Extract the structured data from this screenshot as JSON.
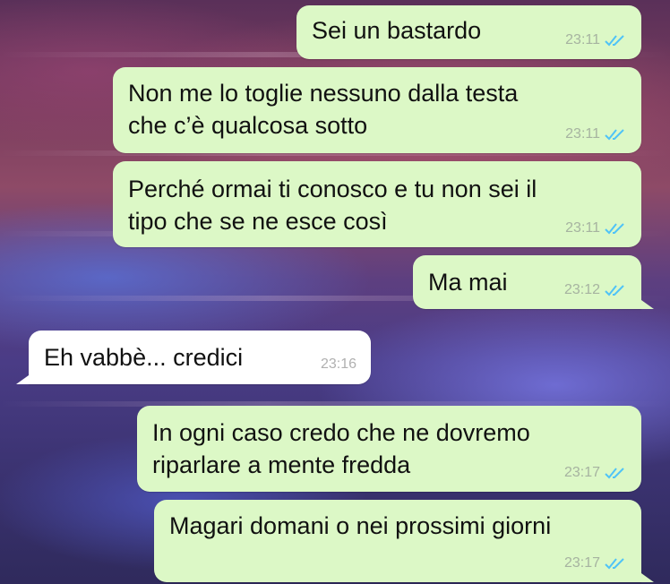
{
  "messages": [
    {
      "direction": "out",
      "lines": [
        "Sei un bastardo"
      ],
      "time": "23:11",
      "status": "read"
    },
    {
      "direction": "out",
      "lines": [
        "Non me lo toglie nessuno dalla testa",
        "che c’è qualcosa sotto"
      ],
      "time": "23:11",
      "status": "read"
    },
    {
      "direction": "out",
      "lines": [
        "Perché ormai ti conosco e tu non sei il",
        "tipo che se ne esce così"
      ],
      "time": "23:11",
      "status": "read"
    },
    {
      "direction": "out",
      "lines": [
        "Ma mai"
      ],
      "time": "23:12",
      "status": "read"
    },
    {
      "direction": "in",
      "lines": [
        "Eh vabbè... credici"
      ],
      "time": "23:16"
    },
    {
      "direction": "out",
      "lines": [
        "In ogni caso credo che ne dovremo",
        "riparlare a mente fredda"
      ],
      "time": "23:17",
      "status": "read"
    },
    {
      "direction": "out",
      "lines": [
        "Magari domani o nei prossimi giorni"
      ],
      "time": "23:17",
      "status": "read"
    }
  ],
  "colors": {
    "outgoing_bubble": "#dcf8c6",
    "incoming_bubble": "#ffffff",
    "read_ticks": "#4fc3f7"
  },
  "icons": {
    "read_receipt": "double-check-icon"
  }
}
